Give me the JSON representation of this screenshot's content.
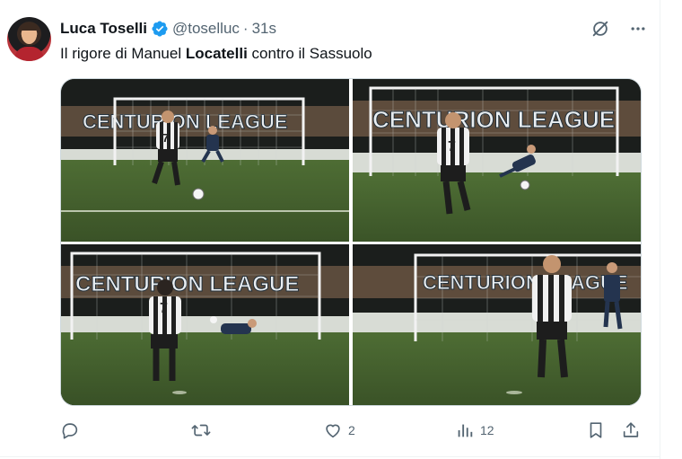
{
  "tweet": {
    "display_name": "Luca Toselli",
    "handle": "@toselluc",
    "separator": "·",
    "time": "31s",
    "text_before": "Il rigore di Manuel ",
    "text_bold": "Locatelli",
    "text_after": " contro il Sassuolo"
  },
  "photos": [
    {
      "banner": "CENTURION LEAGUE",
      "jersey_number": "7"
    },
    {
      "banner": "CENTURION LEAGUE",
      "jersey_number": "7"
    },
    {
      "banner": "CENTURION LEAGUE",
      "jersey_number": "7"
    },
    {
      "banner": "CENTURION LEAGUE",
      "jersey_number": ""
    }
  ],
  "stats": {
    "replies": "",
    "retweets": "",
    "likes": "2",
    "views": "12"
  },
  "icons": {
    "verified": "verified-badge-icon",
    "grok": "grok-icon",
    "more": "more-icon",
    "reply": "reply-icon",
    "retweet": "retweet-icon",
    "like": "heart-icon",
    "views": "views-icon",
    "bookmark": "bookmark-icon",
    "share": "share-icon"
  },
  "colors": {
    "text": "#0f1419",
    "secondary": "#536471",
    "verified": "#1d9bf0",
    "pitch": "#3f5a2a",
    "border": "#cfd9de"
  }
}
